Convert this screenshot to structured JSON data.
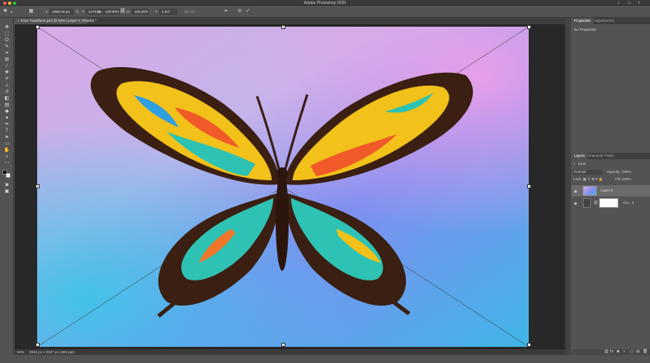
{
  "app": {
    "title": "Adobe Photoshop 2020"
  },
  "options_bar": {
    "x_label": "X:",
    "x_value": "1968.00 px",
    "y_label": "Y:",
    "y_value": "1273.50 px",
    "w_label": "W:",
    "w_value": "100.00%",
    "h_label": "H:",
    "h_value": "100.00%",
    "angle_value": "0.00",
    "angle_unit": "°",
    "interpolation": "Bicubic",
    "cancel_icon": "cancel-icon",
    "commit_icon": "checkmark-icon"
  },
  "document_tab": {
    "label": "Free Transform.psd @ 50% (Layer 0, RGB/8) *"
  },
  "status_bar": {
    "zoom": "50%",
    "doc_info": "3936 px x 2547 px (300 ppi)"
  },
  "properties_panel": {
    "tabs": [
      "Properties",
      "Adjustments"
    ],
    "empty_text": "No Properties"
  },
  "layers_panel": {
    "tabs": [
      "Layers",
      "Channels",
      "Paths"
    ],
    "kind_label": "Kind",
    "blend_mode": "Normal",
    "opacity_label": "Opacity:",
    "opacity_value": "100%",
    "lock_label": "Lock:",
    "fill_label": "Fill:",
    "fill_value": "100%",
    "layers": [
      {
        "name": "Layer 0",
        "selected": true
      },
      {
        "name": "Co... 1",
        "selected": false
      }
    ]
  },
  "colors": {
    "ui_bg": "#535353",
    "canvas_bg": "#282828",
    "panel_header": "#3e3e3e",
    "accent_close": "#ff5f57",
    "accent_min": "#febc2e",
    "accent_max": "#28c840"
  }
}
